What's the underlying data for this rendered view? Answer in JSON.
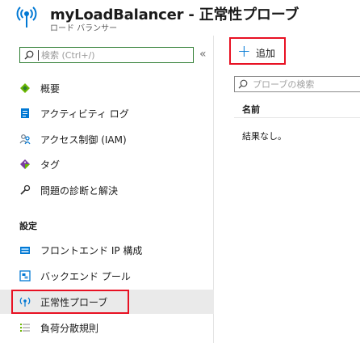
{
  "header": {
    "title": "myLoadBalancer - 正常性プローブ",
    "subtitle": "ロード バランサー",
    "resource_icon": "health-probe-icon"
  },
  "sidebar": {
    "search_placeholder": "検索 (Ctrl+/)",
    "collapse_label": "«",
    "items": [
      {
        "label": "概要",
        "icon": "overview-diamond-icon"
      },
      {
        "label": "アクティビティ ログ",
        "icon": "activity-log-icon"
      },
      {
        "label": "アクセス制御 (IAM)",
        "icon": "people-iam-icon"
      },
      {
        "label": "タグ",
        "icon": "tag-icon"
      },
      {
        "label": "問題の診断と解決",
        "icon": "wrench-icon"
      }
    ],
    "section_settings": "設定",
    "settings_items": [
      {
        "label": "フロントエンド IP 構成",
        "icon": "frontend-ip-icon"
      },
      {
        "label": "バックエンド プール",
        "icon": "backend-pool-icon"
      },
      {
        "label": "正常性プローブ",
        "icon": "health-probe-icon",
        "selected": true
      },
      {
        "label": "負荷分散規則",
        "icon": "load-balancing-rules-icon"
      }
    ]
  },
  "main": {
    "add_label": "追加",
    "filter_placeholder": "プローブの検索",
    "column_name": "名前",
    "no_results": "結果なし。"
  },
  "colors": {
    "accent_blue": "#0078d4",
    "highlight_red": "#e81123",
    "search_border_green": "#2e7d32",
    "selected_bg": "#eaeaea"
  }
}
